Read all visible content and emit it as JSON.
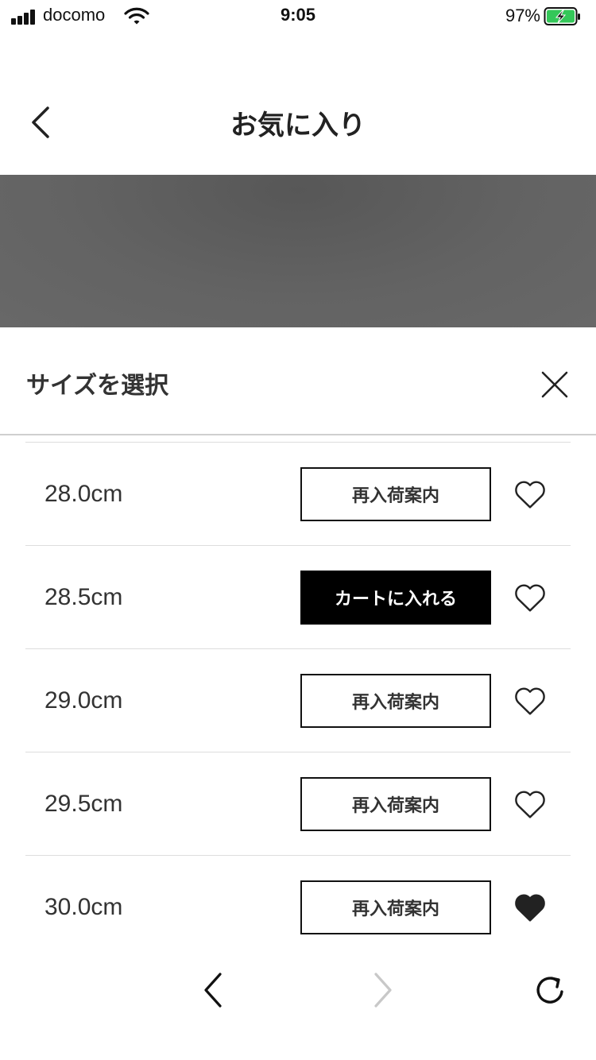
{
  "status_bar": {
    "carrier": "docomo",
    "time": "9:05",
    "battery": "97%",
    "battery_color": "#34c759"
  },
  "header": {
    "title": "お気に入り",
    "back_icon": "chevron-left-icon"
  },
  "sheet": {
    "title": "サイズを選択",
    "close_icon": "close-icon"
  },
  "sizes": [
    {
      "size": "28.0cm",
      "action": "再入荷案内",
      "primary": false,
      "favorited": false
    },
    {
      "size": "28.5cm",
      "action": "カートに入れる",
      "primary": true,
      "favorited": false
    },
    {
      "size": "29.0cm",
      "action": "再入荷案内",
      "primary": false,
      "favorited": false
    },
    {
      "size": "29.5cm",
      "action": "再入荷案内",
      "primary": false,
      "favorited": false
    },
    {
      "size": "30.0cm",
      "action": "再入荷案内",
      "primary": false,
      "favorited": true
    }
  ],
  "toolbar": {
    "back_icon": "chevron-left-icon",
    "forward_icon": "chevron-right-icon",
    "reload_icon": "reload-icon",
    "forward_enabled": false
  }
}
